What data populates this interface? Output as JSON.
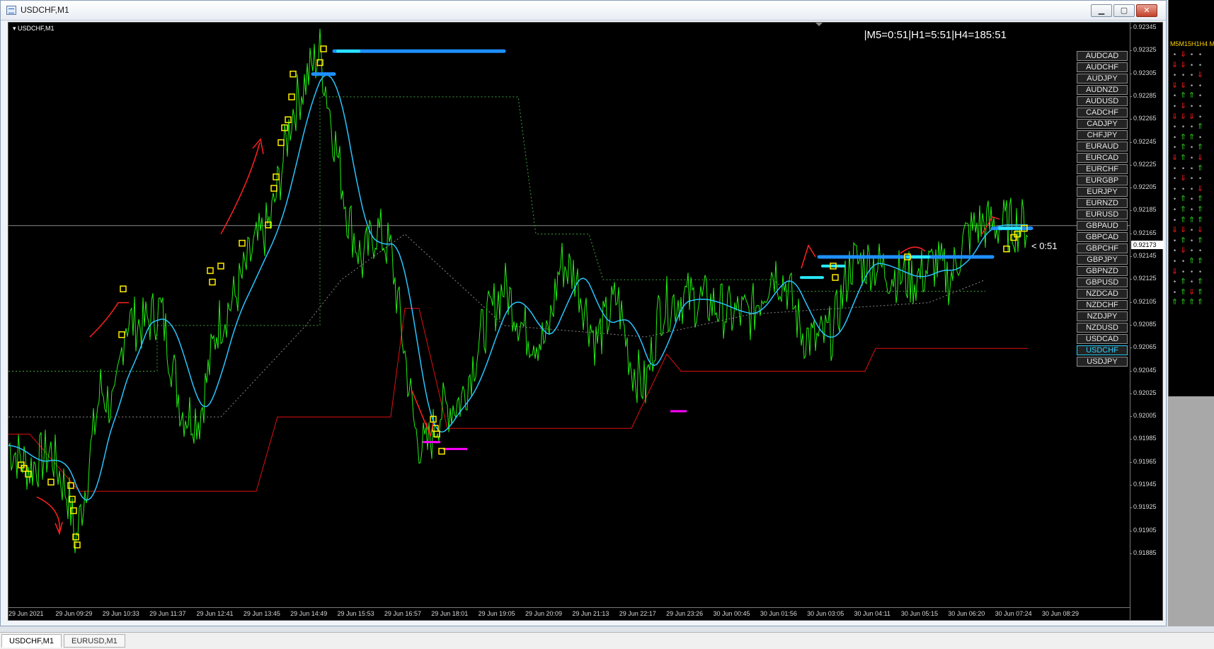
{
  "window": {
    "title": "USDCHF,M1",
    "minimize_glyph": "▁",
    "maximize_glyph": "▢",
    "close_glyph": "✕"
  },
  "chart": {
    "symbol_label": "USDCHF,M1",
    "timer": "|M5=0:51|H1=5:51|H4=185:51",
    "countdown": "< 0:51",
    "current_price": "0.92173",
    "price_ticks": [
      "0.92345",
      "0.92325",
      "0.92305",
      "0.92285",
      "0.92265",
      "0.92245",
      "0.92225",
      "0.92205",
      "0.92185",
      "0.92165",
      "0.92145",
      "0.92125",
      "0.92105",
      "0.92085",
      "0.92065",
      "0.92045",
      "0.92025",
      "0.92005",
      "0.91985",
      "0.91965",
      "0.91945",
      "0.91925",
      "0.91905",
      "0.91885"
    ],
    "time_ticks": [
      "29 Jun 2021",
      "29 Jun 09:29",
      "29 Jun 10:33",
      "29 Jun 11:37",
      "29 Jun 12:41",
      "29 Jun 13:45",
      "29 Jun 14:49",
      "29 Jun 15:53",
      "29 Jun 16:57",
      "29 Jun 18:01",
      "29 Jun 19:05",
      "29 Jun 20:09",
      "29 Jun 21:13",
      "29 Jun 22:17",
      "29 Jun 23:26",
      "30 Jun 00:45",
      "30 Jun 01:56",
      "30 Jun 03:05",
      "30 Jun 04:11",
      "30 Jun 05:15",
      "30 Jun 06:20",
      "30 Jun 07:24",
      "30 Jun 08:29"
    ],
    "colors": {
      "price_line": "#22ee11",
      "moving_average": "#29c4ff",
      "support": "#e01010",
      "resistance_band": "#1e90ff",
      "low_marker": "#ff00ff",
      "signal_box": "#ffee00",
      "annotation": "#ff2020"
    }
  },
  "pairs": {
    "items": [
      "AUDCAD",
      "AUDCHF",
      "AUDJPY",
      "AUDNZD",
      "AUDUSD",
      "CADCHF",
      "CADJPY",
      "CHFJPY",
      "EURAUD",
      "EURCAD",
      "EURCHF",
      "EURGBP",
      "EURJPY",
      "EURNZD",
      "EURUSD",
      "GBPAUD",
      "GBPCAD",
      "GBPCHF",
      "GBPJPY",
      "GBPNZD",
      "GBPUSD",
      "NZDCAD",
      "NZDCHF",
      "NZDJPY",
      "NZDUSD",
      "USDCAD",
      "USDCHF",
      "USDJPY"
    ],
    "active": "USDCHF"
  },
  "side_panel": {
    "header": "M5M15H1H4 M",
    "rows": [
      [
        "n",
        "d",
        "n",
        "n"
      ],
      [
        "d",
        "d",
        "n",
        "n"
      ],
      [
        "n",
        "n",
        "n",
        "d"
      ],
      [
        "d",
        "d",
        "n",
        "n"
      ],
      [
        "n",
        "u",
        "u",
        "n"
      ],
      [
        "n",
        "d",
        "n",
        "n"
      ],
      [
        "d",
        "d",
        "d",
        "n"
      ],
      [
        "n",
        "n",
        "n",
        "u"
      ],
      [
        "n",
        "u",
        "u",
        "n"
      ],
      [
        "n",
        "u",
        "n",
        "u"
      ],
      [
        "d",
        "u",
        "n",
        "d"
      ],
      [
        "n",
        "n",
        "n",
        "u"
      ],
      [
        "n",
        "d",
        "n",
        "n"
      ],
      [
        "n",
        "n",
        "n",
        "d"
      ],
      [
        "n",
        "u",
        "n",
        "u"
      ],
      [
        "n",
        "u",
        "n",
        "u"
      ],
      [
        "n",
        "u",
        "u",
        "u"
      ],
      [
        "d",
        "d",
        "n",
        "d"
      ],
      [
        "n",
        "u",
        "n",
        "u"
      ],
      [
        "n",
        "d",
        "n",
        "n"
      ],
      [
        "n",
        "n",
        "u",
        "u"
      ],
      [
        "d",
        "n",
        "n",
        "n"
      ],
      [
        "n",
        "u",
        "n",
        "u"
      ],
      [
        "n",
        "u",
        "d",
        "u"
      ],
      [
        "u",
        "u",
        "u",
        "u"
      ]
    ]
  },
  "tabs": [
    {
      "label": "USDCHF,M1",
      "active": true
    },
    {
      "label": "EURUSD,M1",
      "active": false
    }
  ]
}
